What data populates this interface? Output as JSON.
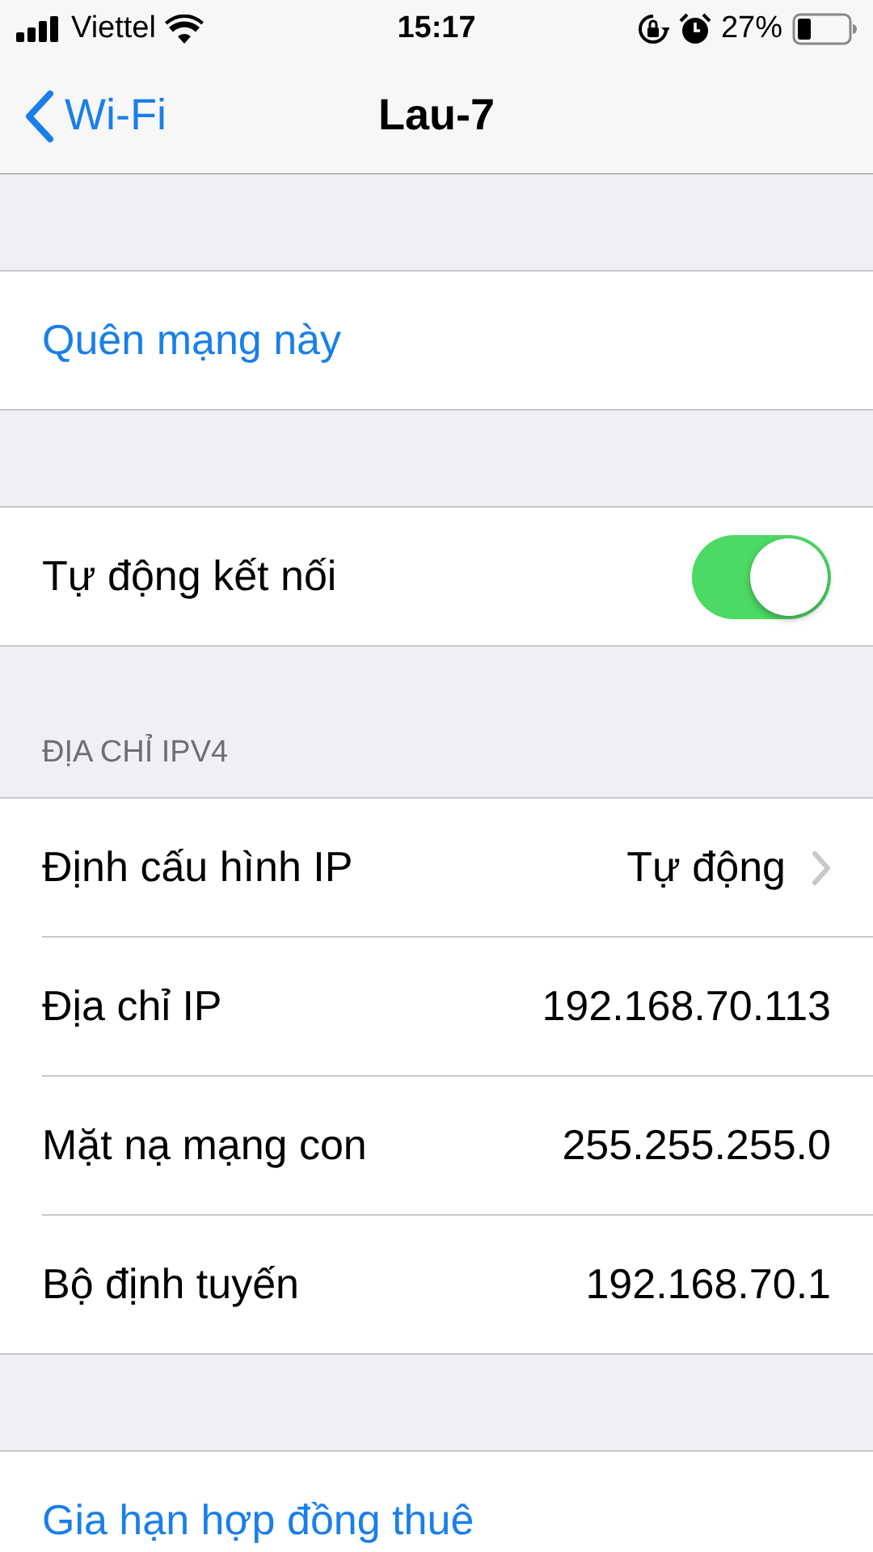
{
  "status_bar": {
    "carrier": "Viettel",
    "time": "15:17",
    "battery": "27%"
  },
  "nav": {
    "back": "Wi-Fi",
    "title": "Lau-7"
  },
  "sections": [
    {
      "rows": [
        {
          "kind": "action",
          "label": "Quên mạng này"
        }
      ]
    },
    {
      "rows": [
        {
          "kind": "toggle",
          "label": "Tự động kết nối",
          "on": true
        }
      ]
    },
    {
      "header": "ĐỊA CHỈ IPV4",
      "rows": [
        {
          "kind": "disclosure",
          "label": "Định cấu hình IP",
          "value": "Tự động"
        },
        {
          "kind": "value",
          "label": "Địa chỉ IP",
          "value": "192.168.70.113"
        },
        {
          "kind": "value",
          "label": "Mặt nạ mạng con",
          "value": "255.255.255.0"
        },
        {
          "kind": "value",
          "label": "Bộ định tuyến",
          "value": "192.168.70.1"
        }
      ]
    },
    {
      "rows": [
        {
          "kind": "action",
          "label": "Gia hạn hợp đồng thuê"
        }
      ]
    }
  ]
}
